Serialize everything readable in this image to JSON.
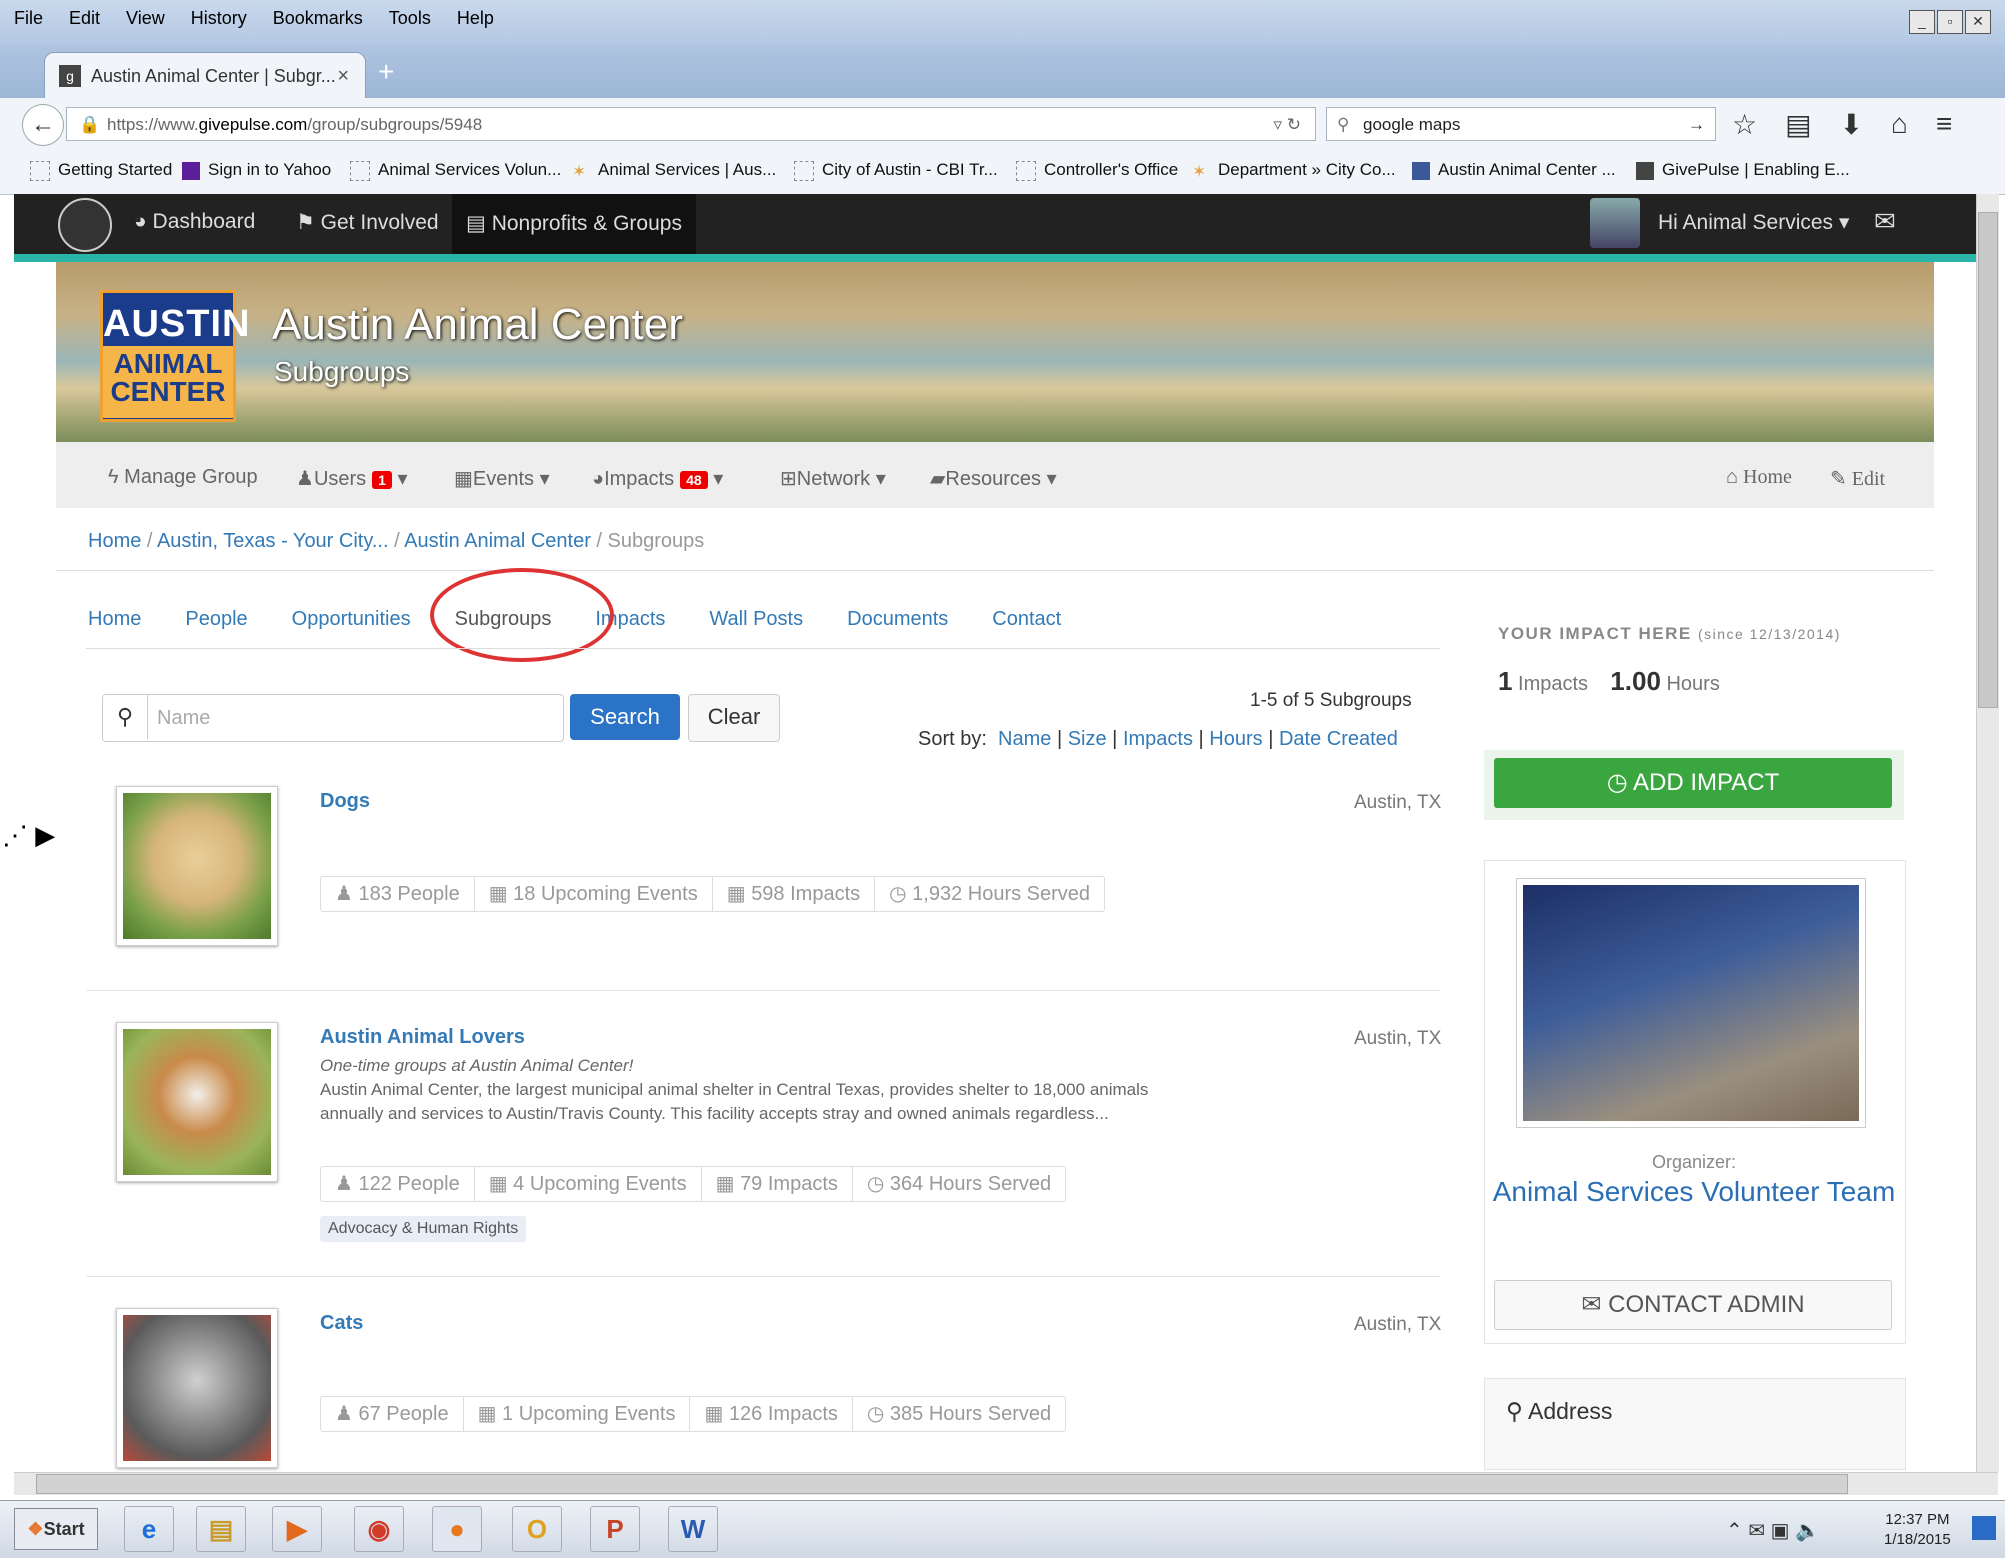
{
  "browser": {
    "menu": [
      "File",
      "Edit",
      "View",
      "History",
      "Bookmarks",
      "Tools",
      "Help"
    ],
    "tab_title": "Austin Animal Center | Subgr...",
    "url_prefix": "https://www.",
    "url_domain": "givepulse.com",
    "url_path": "/group/subgroups/5948",
    "search_value": "google maps",
    "bookmarks": [
      "Getting Started",
      "Sign in to Yahoo",
      "Animal Services Volun...",
      "Animal Services | Aus...",
      "City of Austin - CBI Tr...",
      "Controller's Office",
      "Department » City Co...",
      "Austin Animal Center ...",
      "GivePulse | Enabling E..."
    ]
  },
  "site_nav": {
    "dashboard": "Dashboard",
    "get_involved": "Get Involved",
    "nonprofits": "Nonprofits & Groups",
    "greeting": "Hi Animal Services"
  },
  "banner": {
    "logo_line1": "AUSTIN",
    "logo_line2": "ANIMAL",
    "logo_line3": "CENTER",
    "title": "Austin Animal Center",
    "subtitle": "Subgroups"
  },
  "group_nav": {
    "manage": "Manage Group",
    "users": "Users",
    "users_badge": "1",
    "events": "Events",
    "impacts": "Impacts",
    "impacts_badge": "48",
    "network": "Network",
    "resources": "Resources",
    "home": "Home",
    "edit": "Edit"
  },
  "breadcrumb": [
    "Home",
    "Austin, Texas - Your City...",
    "Austin Animal Center",
    "Subgroups"
  ],
  "subtabs": [
    "Home",
    "People",
    "Opportunities",
    "Subgroups",
    "Impacts",
    "Wall Posts",
    "Documents",
    "Contact"
  ],
  "search": {
    "placeholder": "Name",
    "search_label": "Search",
    "clear_label": "Clear",
    "count": "1-5 of 5 Subgroups",
    "sort_label": "Sort by:",
    "sort_options": [
      "Name",
      "Size",
      "Impacts",
      "Hours",
      "Date Created"
    ]
  },
  "subgroups": [
    {
      "name": "Dogs",
      "location": "Austin, TX",
      "people": "183 People",
      "events": "18 Upcoming Events",
      "impacts": "598 Impacts",
      "hours": "1,932 Hours Served"
    },
    {
      "name": "Austin Animal Lovers",
      "location": "Austin, TX",
      "tagline": "One-time groups at Austin Animal Center!",
      "description": "Austin Animal Center, the largest municipal animal shelter in Central Texas, provides shelter to 18,000 animals annually and services to Austin/Travis County. This facility accepts stray and owned animals regardless...",
      "people": "122 People",
      "events": "4 Upcoming Events",
      "impacts": "79 Impacts",
      "hours": "364 Hours Served",
      "tag": "Advocacy & Human Rights"
    },
    {
      "name": "Cats",
      "location": "Austin, TX",
      "people": "67 People",
      "events": "1 Upcoming Events",
      "impacts": "126 Impacts",
      "hours": "385 Hours Served"
    }
  ],
  "sidebar": {
    "impact_title": "YOUR IMPACT HERE",
    "impact_since": "(since 12/13/2014)",
    "impacts_num": "1",
    "impacts_lbl": "Impacts",
    "hours_num": "1.00",
    "hours_lbl": "Hours",
    "add_impact": "ADD IMPACT",
    "organizer_label": "Organizer:",
    "organizer_name": "Animal Services Volunteer Team",
    "contact_admin": "CONTACT ADMIN",
    "address_label": "Address"
  },
  "taskbar": {
    "start": "Start",
    "time": "12:37 PM",
    "date": "1/18/2015"
  }
}
